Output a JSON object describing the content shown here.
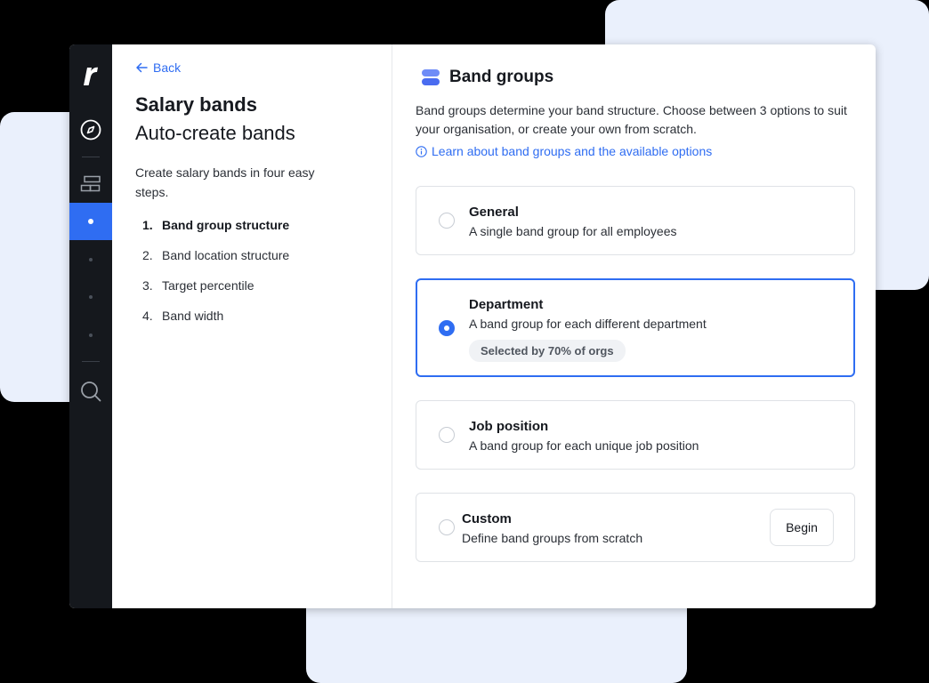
{
  "back": {
    "label": "Back"
  },
  "left": {
    "title": "Salary bands",
    "subtitle": "Auto-create bands",
    "intro": "Create salary bands in four easy steps.",
    "steps": [
      {
        "num": "1.",
        "label": "Band group structure"
      },
      {
        "num": "2.",
        "label": "Band location structure"
      },
      {
        "num": "3.",
        "label": "Target percentile"
      },
      {
        "num": "4.",
        "label": "Band width"
      }
    ]
  },
  "main": {
    "title": "Band groups",
    "description": "Band groups determine your band structure. Choose between 3 options to suit your organisation, or create your own from scratch.",
    "learn_link": "Learn about band groups and the available options",
    "options": [
      {
        "title": "General",
        "subtitle": "A single band group for all employees"
      },
      {
        "title": "Department",
        "subtitle": "A band group for each different department",
        "badge": "Selected by 70% of orgs"
      },
      {
        "title": "Job position",
        "subtitle": "A band group for each unique job position"
      },
      {
        "title": "Custom",
        "subtitle": "Define band groups from scratch",
        "button": "Begin"
      }
    ],
    "selected_option": "Department"
  },
  "colors": {
    "accent": "#2f6df2",
    "rail": "#15181d",
    "decor": "#eaf0fc"
  }
}
